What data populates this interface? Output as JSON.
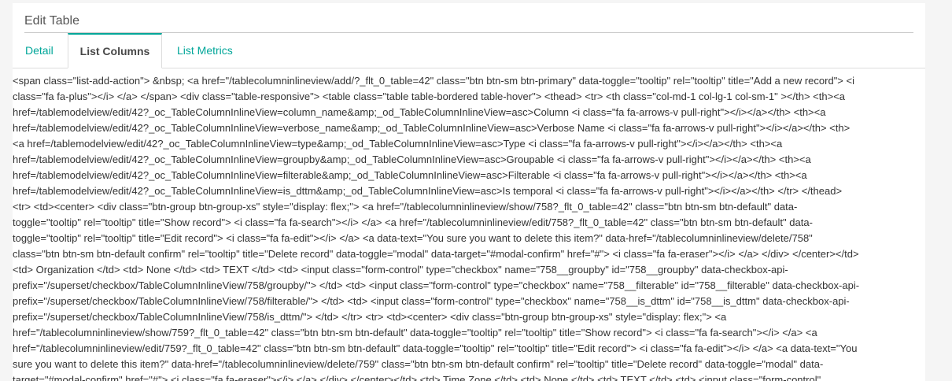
{
  "panel": {
    "title": "Edit Table"
  },
  "tabs": [
    {
      "label": "Detail",
      "active": false
    },
    {
      "label": "List Columns",
      "active": true
    },
    {
      "label": "List Metrics",
      "active": false
    }
  ],
  "colors": {
    "accent": "#00a699",
    "active_tab_text": "#484848",
    "body_text": "#333333",
    "page_bg": "#f5f5f5"
  },
  "raw_html_lines": [
    "<span class=\"list-add-action\"> &nbsp; <a href=\"/tablecolumninlineview/add/?_flt_0_table=42\" class=\"btn btn-sm btn-primary\" data-toggle=\"tooltip\" rel=\"tooltip\" title=\"Add a new record\"> <i",
    "class=\"fa fa-plus\"></i> </a> </span> <div class=\"table-responsive\"> <table class=\"table table-bordered table-hover\"> <thead> <tr> <th class=\"col-md-1 col-lg-1 col-sm-1\" ></th> <th><a",
    "href=/tablemodelview/edit/42?_oc_TableColumnInlineView=column_name&amp;_od_TableColumnInlineView=asc>Column <i class=\"fa fa-arrows-v pull-right\"></i></a></th> <th><a",
    "href=/tablemodelview/edit/42?_oc_TableColumnInlineView=verbose_name&amp;_od_TableColumnInlineView=asc>Verbose Name <i class=\"fa fa-arrows-v pull-right\"></i></a></th> <th>",
    "<a href=/tablemodelview/edit/42?_oc_TableColumnInlineView=type&amp;_od_TableColumnInlineView=asc>Type <i class=\"fa fa-arrows-v pull-right\"></i></a></th> <th><a",
    "href=/tablemodelview/edit/42?_oc_TableColumnInlineView=groupby&amp;_od_TableColumnInlineView=asc>Groupable <i class=\"fa fa-arrows-v pull-right\"></i></a></th> <th><a",
    "href=/tablemodelview/edit/42?_oc_TableColumnInlineView=filterable&amp;_od_TableColumnInlineView=asc>Filterable <i class=\"fa fa-arrows-v pull-right\"></i></a></th> <th><a",
    "href=/tablemodelview/edit/42?_oc_TableColumnInlineView=is_dttm&amp;_od_TableColumnInlineView=asc>Is temporal <i class=\"fa fa-arrows-v pull-right\"></i></a></th> </tr> </thead>",
    "<tr> <td><center> <div class=\"btn-group btn-group-xs\" style=\"display: flex;\"> <a href=\"/tablecolumninlineview/show/758?_flt_0_table=42\" class=\"btn btn-sm btn-default\" data-",
    "toggle=\"tooltip\" rel=\"tooltip\" title=\"Show record\"> <i class=\"fa fa-search\"></i> </a> <a href=\"/tablecolumninlineview/edit/758?_flt_0_table=42\" class=\"btn btn-sm btn-default\" data-",
    "toggle=\"tooltip\" rel=\"tooltip\" title=\"Edit record\"> <i class=\"fa fa-edit\"></i> </a> <a data-text=\"You sure you want to delete this item?\" data-href=\"/tablecolumninlineview/delete/758\"",
    "class=\"btn btn-sm btn-default confirm\" rel=\"tooltip\" title=\"Delete record\" data-toggle=\"modal\" data-target=\"#modal-confirm\" href=\"#\"> <i class=\"fa fa-eraser\"></i> </a> </div> </center></td>",
    "<td> Organization </td> <td> None </td> <td> TEXT </td> <td> <input class=\"form-control\" type=\"checkbox\" name=\"758__groupby\" id=\"758__groupby\" data-checkbox-api-",
    "prefix=\"/superset/checkbox/TableColumnInlineView/758/groupby/\"> </td> <td> <input class=\"form-control\" type=\"checkbox\" name=\"758__filterable\" id=\"758__filterable\" data-checkbox-api-",
    "prefix=\"/superset/checkbox/TableColumnInlineView/758/filterable/\"> </td> <td> <input class=\"form-control\" type=\"checkbox\" name=\"758__is_dttm\" id=\"758__is_dttm\" data-checkbox-api-",
    "prefix=\"/superset/checkbox/TableColumnInlineView/758/is_dttm/\"> </td> </tr> <tr> <td><center> <div class=\"btn-group btn-group-xs\" style=\"display: flex;\"> <a",
    "href=\"/tablecolumninlineview/show/759?_flt_0_table=42\" class=\"btn btn-sm btn-default\" data-toggle=\"tooltip\" rel=\"tooltip\" title=\"Show record\"> <i class=\"fa fa-search\"></i> </a> <a",
    "href=\"/tablecolumninlineview/edit/759?_flt_0_table=42\" class=\"btn btn-sm btn-default\" data-toggle=\"tooltip\" rel=\"tooltip\" title=\"Edit record\"> <i class=\"fa fa-edit\"></i> </a> <a data-text=\"You",
    "sure you want to delete this item?\" data-href=\"/tablecolumninlineview/delete/759\" class=\"btn btn-sm btn-default confirm\" rel=\"tooltip\" title=\"Delete record\" data-toggle=\"modal\" data-",
    "target=\"#modal-confirm\" href=\"#\"> <i class=\"fa fa-eraser\"></i> </a> </div> </center></td> <td> Time Zone </td> <td> None </td> <td> TEXT </td> <td> <input class=\"form-control\""
  ]
}
